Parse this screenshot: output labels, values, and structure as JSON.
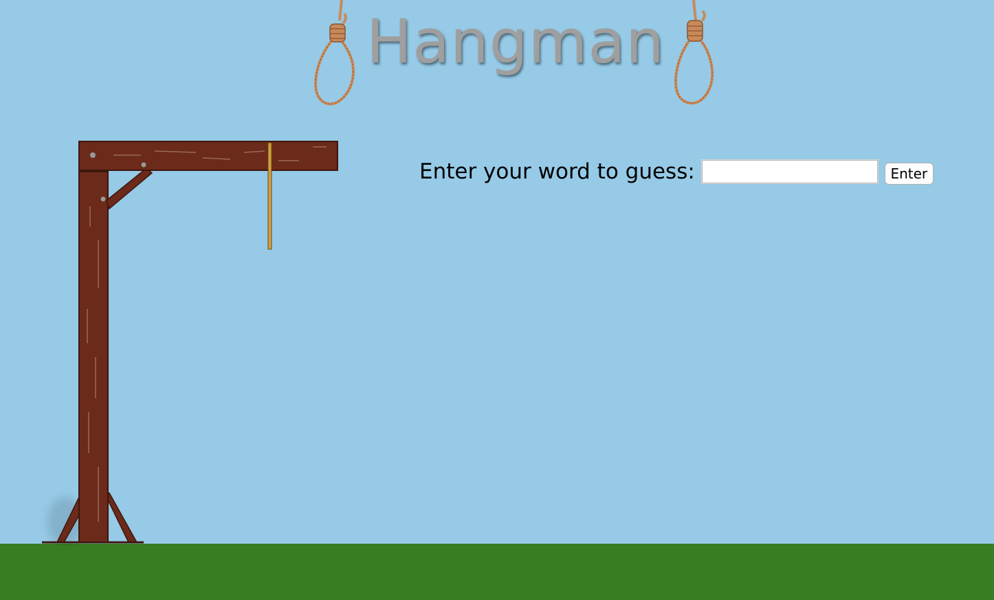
{
  "title": "Hangman",
  "form": {
    "prompt": "Enter your word to guess:",
    "input_value": "",
    "input_placeholder": "",
    "enter_label": "Enter"
  },
  "icons": {
    "left_noose": "noose-icon",
    "right_noose": "noose-icon",
    "gallows": "gallows-icon"
  },
  "colors": {
    "sky": "#96cae7",
    "ground": "#377e22",
    "wood": "#6b2a1a",
    "rope": "#c98a5a",
    "title": "#9f9f9f"
  }
}
